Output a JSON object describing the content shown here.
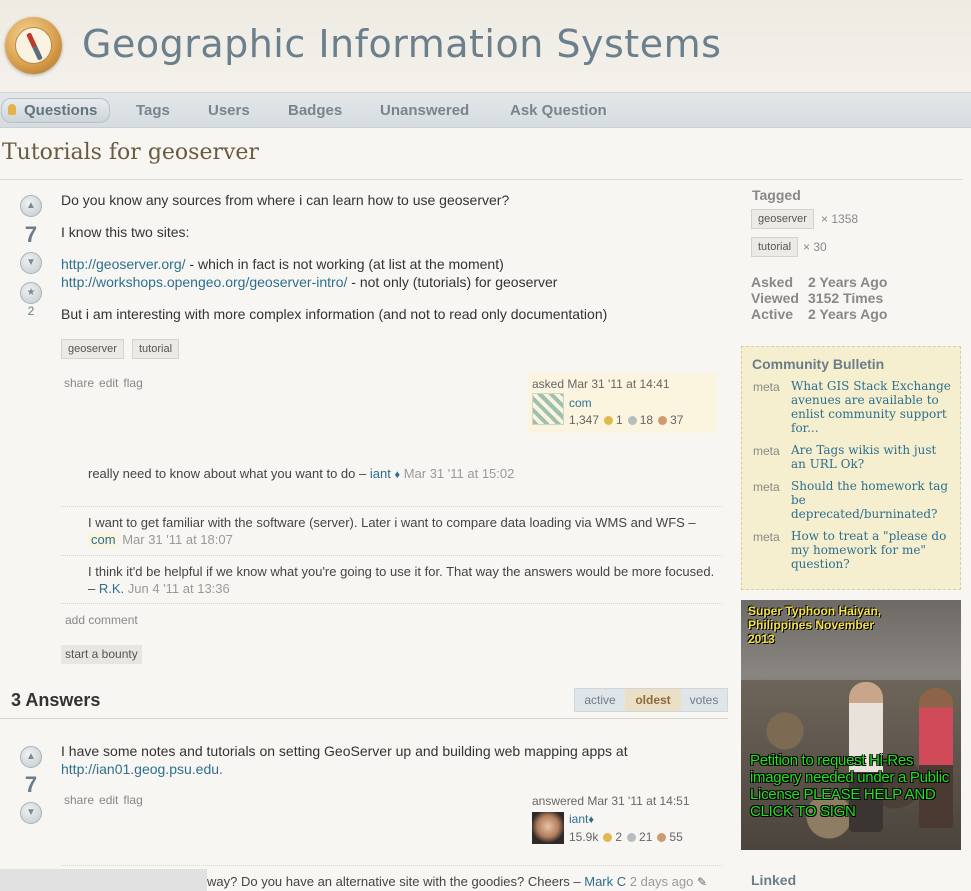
{
  "site": {
    "title": "Geographic Information Systems"
  },
  "nav": {
    "items": [
      {
        "label": "Questions"
      },
      {
        "label": "Tags"
      },
      {
        "label": "Users"
      },
      {
        "label": "Badges"
      },
      {
        "label": "Unanswered"
      },
      {
        "label": "Ask Question"
      }
    ]
  },
  "question": {
    "title": "Tutorials for geoserver",
    "votes": "7",
    "favorites": "2",
    "body": {
      "p1": "Do you know any sources from where i can learn how to use geoserver?",
      "p2": "I know this two sites:",
      "link1": "http://geoserver.org/",
      "link1_suffix": " - which in fact is not working (at list at the moment)",
      "link2": "http://workshops.opengeo.org/geoserver-intro/",
      "link2_suffix": " - not only (tutorials) for geoserver",
      "p4": "But i am interesting with more complex information (and not to read only documentation)"
    },
    "tags": [
      "geoserver",
      "tutorial"
    ],
    "menu": {
      "share": "share",
      "edit": "edit",
      "flag": "flag"
    },
    "owner": {
      "asked_label": "asked",
      "time": "Mar 31 '11 at 14:41",
      "name": "com",
      "rep": "1,347",
      "gold": "1",
      "silver": "18",
      "bronze": "37"
    },
    "comments": [
      {
        "text": "really need to know about what you want to do – ",
        "user": "iant",
        "mod": "♦",
        "time": "Mar 31 '11 at 15:02"
      },
      {
        "text": "I want to get familiar with the software (server). Later i want to compare data loading via WMS and WFS – ",
        "user": "com",
        "time": "Mar 31 '11 at 18:07"
      },
      {
        "text": "I think it'd be helpful if we know what you're going to use it for. That way the answers would be more focused. – ",
        "user": "R.K.",
        "time": "Jun 4 '11 at 13:36"
      }
    ],
    "add_comment": "add comment",
    "bounty": "start a bounty"
  },
  "answers": {
    "header": "3 Answers",
    "sort": [
      {
        "label": "active"
      },
      {
        "label": "oldest"
      },
      {
        "label": "votes"
      }
    ],
    "first": {
      "votes": "7",
      "text": "I have some notes and tutorials on setting GeoServer up and building web mapping apps at",
      "link": "http://ian01.geog.psu.edu.",
      "menu": {
        "share": "share",
        "edit": "edit",
        "flag": "flag"
      },
      "owner": {
        "answered_label": "answered",
        "time": "Mar 31 '11 at 14:51",
        "name": "iant",
        "mod": "♦",
        "rep": "15.9k",
        "gold": "2",
        "silver": "21",
        "bronze": "55"
      },
      "comment_partial": "way? Do you have an alternative site with the goodies? Cheers – ",
      "comment_user": "Mark C",
      "comment_time": "2 days ago",
      "comment_edit_icon": "✎"
    }
  },
  "sidebar": {
    "tagged_label": "Tagged",
    "tags": [
      {
        "name": "geoserver",
        "count": "× 1358"
      },
      {
        "name": "tutorial",
        "count": "× 30"
      }
    ],
    "stats": [
      {
        "label": "Asked",
        "value": "2 Years Ago"
      },
      {
        "label": "Viewed",
        "value": "3152 Times"
      },
      {
        "label": "Active",
        "value": "2 Years Ago"
      }
    ],
    "bulletin": {
      "title": "Community Bulletin",
      "items": [
        {
          "meta": "meta",
          "text": "What GIS Stack Exchange avenues are available to enlist community support for..."
        },
        {
          "meta": "meta",
          "text": "Are Tags wikis with just an URL Ok?"
        },
        {
          "meta": "meta",
          "text": "Should the homework tag be deprecated/burninated?"
        },
        {
          "meta": "meta",
          "text": "How to treat a \"please do my homework for me\" question?"
        }
      ]
    },
    "ad": {
      "top": "Super Typhoon Haiyan, Philippines November 2013",
      "bottom": "Petition to request Hi-Res imagery needed under a Public License PLEASE HELP AND CLICK TO SIGN"
    },
    "linked": "Linked"
  }
}
